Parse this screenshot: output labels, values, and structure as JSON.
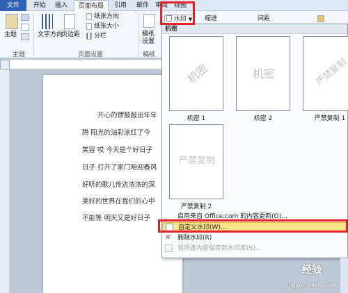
{
  "menubar": {
    "tabs": [
      "文件",
      "开始",
      "插入",
      "页面布局",
      "引用",
      "邮件",
      "审阅",
      "视图"
    ],
    "active_tab": "页面布局"
  },
  "ribbon": {
    "theme_group": {
      "button": "主题",
      "label": "主题"
    },
    "page_setup": {
      "text_direction": "文字方向",
      "margins": "页边距",
      "orientation": "纸张方向",
      "size": "纸张大小",
      "columns": "分栏",
      "label": "页面设置"
    },
    "manuscript": {
      "button": "稿纸设置",
      "button_line1": "稿纸",
      "button_line2": "设置",
      "label": "稿纸"
    },
    "watermark_button": "水印",
    "indent_label": "缩进",
    "spacing_label": "间距"
  },
  "document": {
    "lines": [
      "开心的锣鼓敲出年年",
      "腾 阳光的油彩涂红了今",
      "笑容 哎 今天是个好日子",
      "日子 打开了家门咱迎春风",
      "好听的歌儿传达浓浓的深",
      "美好的世界在我们的心中",
      "不能等 明天又是好日子"
    ]
  },
  "watermark_menu": {
    "header": "机密",
    "thumbnails": [
      {
        "caption": "机密 1",
        "text": "机密"
      },
      {
        "caption": "机密 2",
        "text": "机密"
      },
      {
        "caption": "严禁复制 1",
        "text": "严禁复制"
      },
      {
        "caption": "严禁复制 2",
        "text": "严禁复制"
      }
    ],
    "items": {
      "office_update": "启用来自 Office.com 的内容更新(O)...",
      "custom": "自定义水印(W)...",
      "remove": "删除水印(R)",
      "save": "将所选内容保存到水印库(S)..."
    }
  },
  "overlay": {
    "site_text": "经验",
    "url": "jingyan.baidu.com"
  },
  "colors": {
    "highlight_red": "#e3202a",
    "file_tab": "#2f62b5",
    "menu_highlight": "#fbe48a"
  }
}
